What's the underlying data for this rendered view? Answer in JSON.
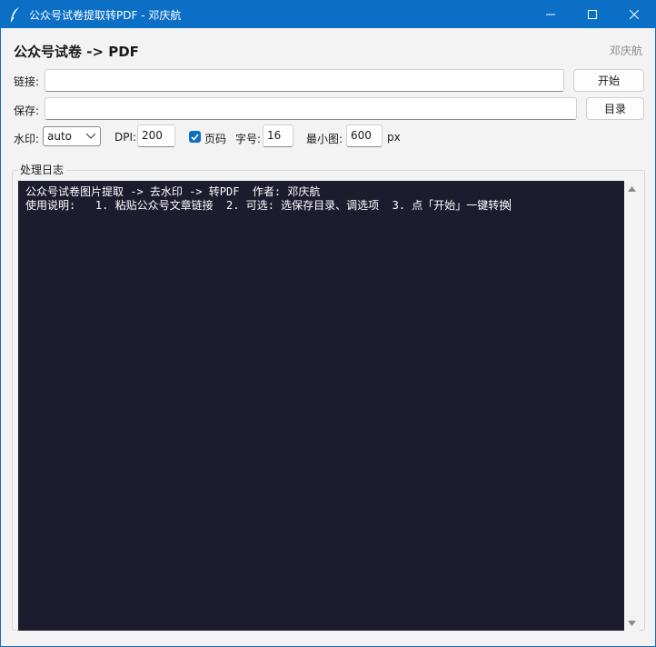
{
  "window": {
    "title": "公众号试卷提取转PDF - 邓庆航",
    "controls": {
      "minimize": "minimize-icon",
      "maximize": "maximize-icon",
      "close": "close-icon"
    }
  },
  "header": {
    "title": "公众号试卷 -> PDF",
    "author": "邓庆航"
  },
  "link_row": {
    "label": "链接:",
    "value": "",
    "start_button": "开始"
  },
  "save_row": {
    "label": "保存:",
    "value": "",
    "dir_button": "目录"
  },
  "options": {
    "watermark_label": "水印:",
    "watermark_value": "auto",
    "dpi_label": "DPI:",
    "dpi_value": "200",
    "page_num_label": "页码",
    "page_num_checked": true,
    "font_size_label": "字号:",
    "font_size_value": "16",
    "min_img_label": "最小图:",
    "min_img_value": "600",
    "min_img_unit": "px"
  },
  "log": {
    "group_title": "处理日志",
    "lines": [
      "公众号试卷图片提取 -> 去水印 -> 转PDF  作者: 邓庆航",
      "使用说明:   1. 粘贴公众号文章链接  2. 可选: 选保存目录、调选项  3. 点「开始」一键转换"
    ]
  },
  "colors": {
    "accent": "#0b6fc6",
    "log_background": "#1d1b2e",
    "window_background": "#f3f3f3"
  }
}
